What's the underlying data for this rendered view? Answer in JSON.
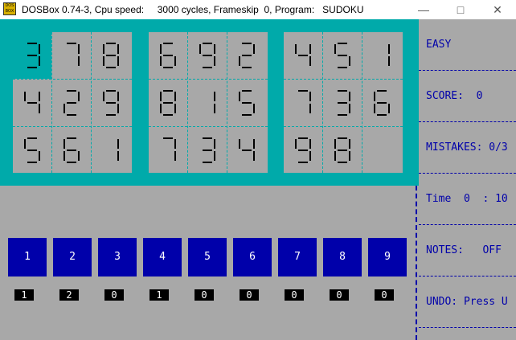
{
  "window": {
    "title": "DOSBox 0.74-3, Cpu speed:     3000 cycles, Frameskip  0, Program:   SUDOKU",
    "icon_label": "DOS BOX",
    "minimize_icon": "minimize-icon",
    "maximize_icon": "maximize-icon",
    "close_icon": "close-icon"
  },
  "board": {
    "cells": [
      [
        "3",
        "7",
        "8",
        "6",
        "9",
        "2",
        "4",
        "5",
        "1"
      ],
      [
        "4",
        "2",
        "9",
        "8",
        "1",
        "5",
        "7",
        "3",
        "6"
      ],
      [
        "5",
        "6",
        "1",
        "7",
        "3",
        "4",
        "9",
        "8",
        ""
      ]
    ],
    "selected": {
      "row": 0,
      "col": 0
    }
  },
  "sidebar": {
    "difficulty": "EASY",
    "score_label": "SCORE:  0",
    "mistakes_label": "MISTAKES: 0/3",
    "time_label": "Time  0  : 10",
    "notes_label": "NOTES:   OFF",
    "undo_label": "UNDO: Press U"
  },
  "number_pad": {
    "buttons": [
      "1",
      "2",
      "3",
      "4",
      "5",
      "6",
      "7",
      "8",
      "9"
    ],
    "counts": [
      "1",
      "2",
      "0",
      "1",
      "0",
      "0",
      "0",
      "0",
      "0"
    ]
  },
  "colors": {
    "board_bg": "#00aaaa",
    "cell_bg": "#a8a8a8",
    "button_bg": "#0000aa",
    "sidebar_text": "#0000aa"
  }
}
